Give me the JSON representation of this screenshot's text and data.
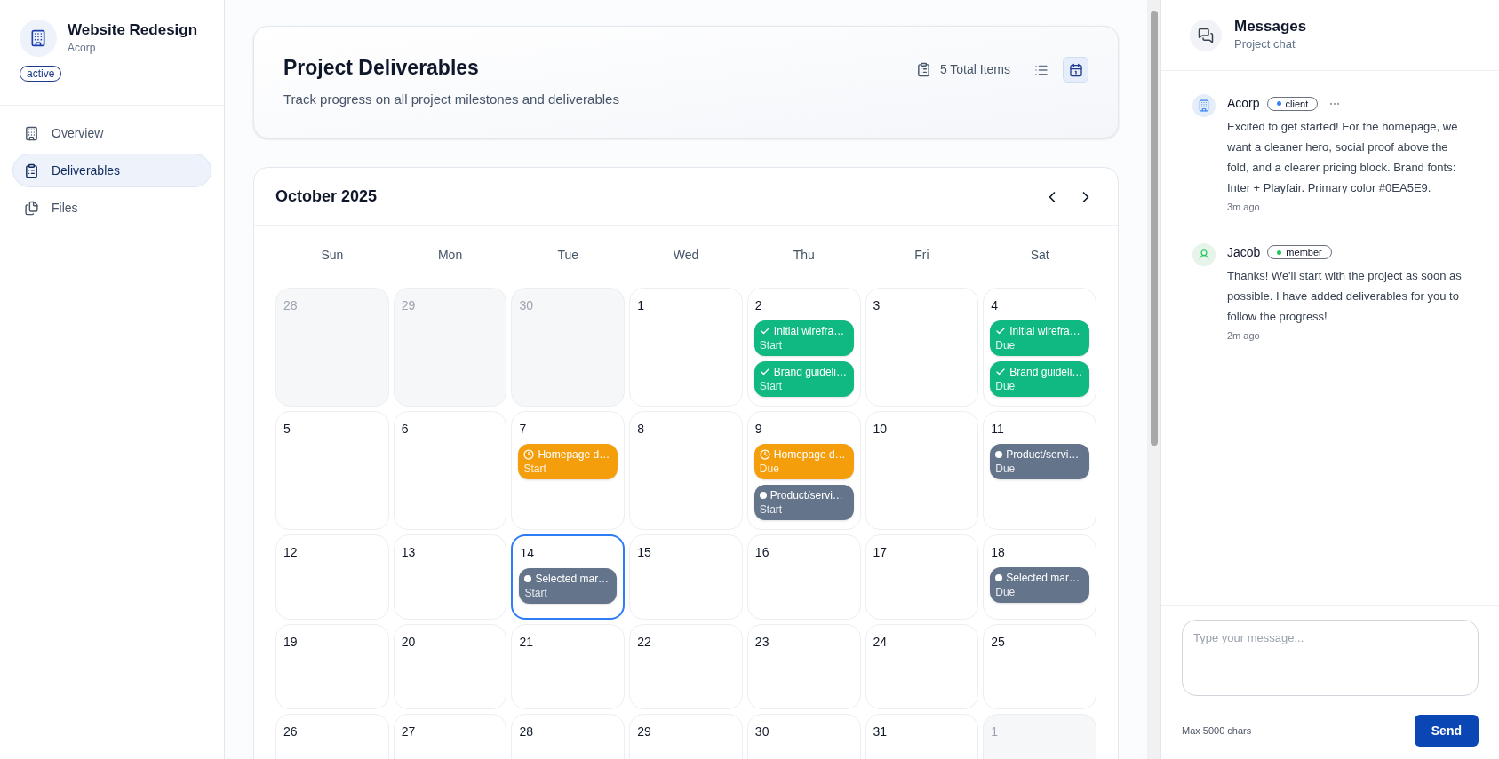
{
  "sidebar": {
    "project": {
      "title": "Website Redesign",
      "client": "Acorp",
      "status": "active"
    },
    "nav": [
      {
        "label": "Overview",
        "kind": "overview",
        "selected": false
      },
      {
        "label": "Deliverables",
        "kind": "deliverables",
        "selected": true
      },
      {
        "label": "Files",
        "kind": "files",
        "selected": false
      }
    ]
  },
  "header": {
    "title": "Project Deliverables",
    "subtitle": "Track progress on all project milestones and deliverables",
    "count": "5 Total Items",
    "views": [
      {
        "kind": "list",
        "selected": false
      },
      {
        "kind": "calendar",
        "selected": true
      }
    ]
  },
  "calendar": {
    "month": "October 2025",
    "weekdays": [
      "Sun",
      "Mon",
      "Tue",
      "Wed",
      "Thu",
      "Fri",
      "Sat"
    ],
    "weeks": [
      [
        {
          "day": "28",
          "outside": true,
          "selected": false
        },
        {
          "day": "29",
          "outside": true,
          "selected": false
        },
        {
          "day": "30",
          "outside": true,
          "selected": false
        },
        {
          "day": "1",
          "outside": false,
          "selected": false
        },
        {
          "day": "2",
          "outside": false,
          "selected": false,
          "events": [
            {
              "title": "Initial wirefra…",
              "label": "Start",
              "kind": "done"
            },
            {
              "title": "Brand guideli…",
              "label": "Start",
              "kind": "done"
            }
          ]
        },
        {
          "day": "3",
          "outside": false,
          "selected": false
        },
        {
          "day": "4",
          "outside": false,
          "selected": false,
          "events": [
            {
              "title": "Initial wirefra…",
              "label": "Due",
              "kind": "done"
            },
            {
              "title": "Brand guideli…",
              "label": "Due",
              "kind": "done"
            }
          ]
        }
      ],
      [
        {
          "day": "5",
          "outside": false,
          "selected": false
        },
        {
          "day": "6",
          "outside": false,
          "selected": false
        },
        {
          "day": "7",
          "outside": false,
          "selected": false,
          "events": [
            {
              "title": "Homepage d…",
              "label": "Start",
              "kind": "in_progress"
            }
          ]
        },
        {
          "day": "8",
          "outside": false,
          "selected": false
        },
        {
          "day": "9",
          "outside": false,
          "selected": false,
          "events": [
            {
              "title": "Homepage d…",
              "label": "Due",
              "kind": "in_progress"
            },
            {
              "title": "Product/servi…",
              "label": "Start",
              "kind": "pending"
            }
          ]
        },
        {
          "day": "10",
          "outside": false,
          "selected": false
        },
        {
          "day": "11",
          "outside": false,
          "selected": false,
          "events": [
            {
              "title": "Product/servi…",
              "label": "Due",
              "kind": "pending"
            }
          ]
        }
      ],
      [
        {
          "day": "12",
          "outside": false,
          "selected": false
        },
        {
          "day": "13",
          "outside": false,
          "selected": false
        },
        {
          "day": "14",
          "outside": false,
          "selected": true,
          "events": [
            {
              "title": "Selected mar…",
              "label": "Start",
              "kind": "pending"
            }
          ]
        },
        {
          "day": "15",
          "outside": false,
          "selected": false
        },
        {
          "day": "16",
          "outside": false,
          "selected": false
        },
        {
          "day": "17",
          "outside": false,
          "selected": false
        },
        {
          "day": "18",
          "outside": false,
          "selected": false,
          "events": [
            {
              "title": "Selected mar…",
              "label": "Due",
              "kind": "pending"
            }
          ]
        }
      ],
      [
        {
          "day": "19",
          "outside": false,
          "selected": false
        },
        {
          "day": "20",
          "outside": false,
          "selected": false
        },
        {
          "day": "21",
          "outside": false,
          "selected": false
        },
        {
          "day": "22",
          "outside": false,
          "selected": false
        },
        {
          "day": "23",
          "outside": false,
          "selected": false
        },
        {
          "day": "24",
          "outside": false,
          "selected": false
        },
        {
          "day": "25",
          "outside": false,
          "selected": false
        }
      ],
      [
        {
          "day": "26",
          "outside": false,
          "selected": false
        },
        {
          "day": "27",
          "outside": false,
          "selected": false
        },
        {
          "day": "28",
          "outside": false,
          "selected": false
        },
        {
          "day": "29",
          "outside": false,
          "selected": false
        },
        {
          "day": "30",
          "outside": false,
          "selected": false
        },
        {
          "day": "31",
          "outside": false,
          "selected": false
        },
        {
          "day": "1",
          "outside": true,
          "selected": false
        }
      ]
    ]
  },
  "messages": {
    "title": "Messages",
    "subtitle": "Project chat",
    "items": [
      {
        "author": "Acorp",
        "kind": "company",
        "role": "client",
        "color": "#3b82f6",
        "menu": true,
        "text": "Excited to get started! For the homepage, we want a cleaner hero, social proof above the fold, and a clearer pricing block. Brand fonts: Inter + Playfair. Primary color #0EA5E9.",
        "time": "3m ago"
      },
      {
        "author": "Jacob",
        "kind": "person",
        "role": "member",
        "color": "#22c55e",
        "menu": false,
        "text": "Thanks! We'll start with the project as soon as possible. I have added deliverables for you to follow the progress!",
        "time": "2m ago"
      }
    ],
    "composer": {
      "placeholder": "Type your message...",
      "hint": "Max 5000 chars",
      "send": "Send"
    }
  }
}
